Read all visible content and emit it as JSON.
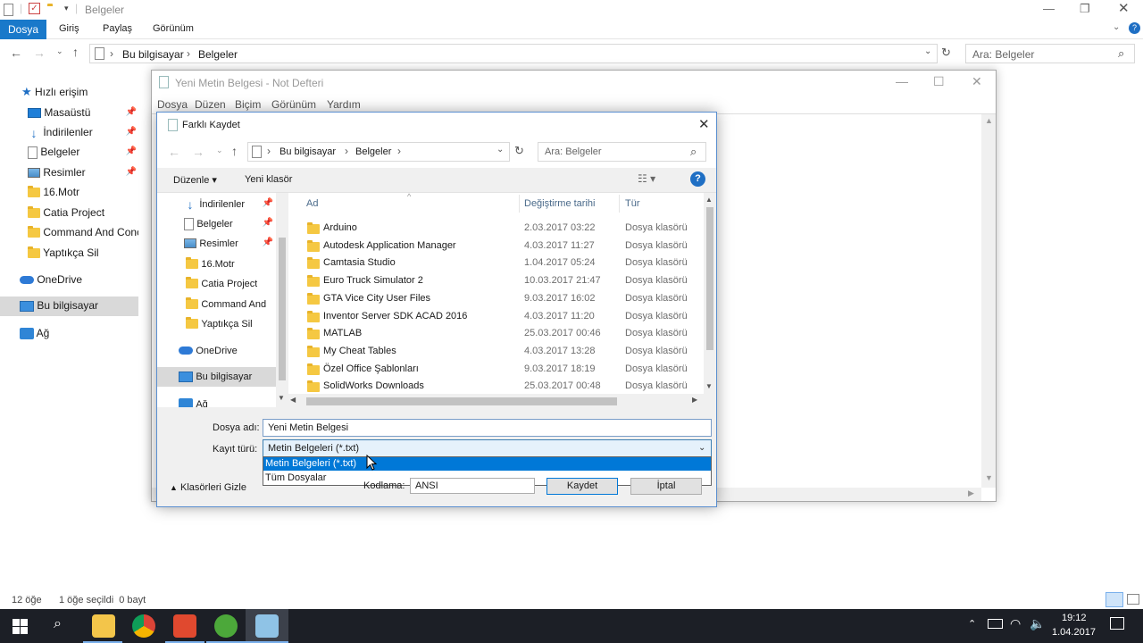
{
  "explorer": {
    "title": "Belgeler",
    "ribbon_tabs": [
      "Dosya",
      "Giriş",
      "Paylaş",
      "Görünüm"
    ],
    "address": [
      "Bu bilgisayar",
      "Belgeler"
    ],
    "search_placeholder": "Ara: Belgeler",
    "sidebar": {
      "quick_access": "Hızlı erişim",
      "items": [
        "Masaüstü",
        "İndirilenler",
        "Belgeler",
        "Resimler",
        "16.Motr",
        "Catia Project",
        "Command And Conc",
        "Yaptıkça Sil"
      ],
      "onedrive": "OneDrive",
      "this_pc": "Bu bilgisayar",
      "network": "Ağ"
    },
    "status": {
      "count": "12 öğe",
      "selected": "1 öğe seçildi  0 bayt"
    }
  },
  "notepad": {
    "title": "Yeni Metin Belgesi - Not Defteri",
    "menu": [
      "Dosya",
      "Düzen",
      "Biçim",
      "Görünüm",
      "Yardım"
    ]
  },
  "dialog": {
    "title": "Farklı Kaydet",
    "address": [
      "Bu bilgisayar",
      "Belgeler"
    ],
    "search_placeholder": "Ara: Belgeler",
    "organize": "Düzenle",
    "new_folder": "Yeni klasör",
    "help": "?",
    "left_items": [
      "İndirilenler",
      "Belgeler",
      "Resimler",
      "16.Motr",
      "Catia Project",
      "Command And",
      "Yaptıkça Sil",
      "OneDrive",
      "Bu bilgisayar",
      "Ağ"
    ],
    "columns": {
      "name": "Ad",
      "date": "Değiştirme tarihi",
      "type": "Tür"
    },
    "files": [
      {
        "name": "Arduino",
        "date": "2.03.2017 03:22",
        "type": "Dosya klasörü"
      },
      {
        "name": "Autodesk Application Manager",
        "date": "4.03.2017 11:27",
        "type": "Dosya klasörü"
      },
      {
        "name": "Camtasia Studio",
        "date": "1.04.2017 05:24",
        "type": "Dosya klasörü"
      },
      {
        "name": "Euro Truck Simulator 2",
        "date": "10.03.2017 21:47",
        "type": "Dosya klasörü"
      },
      {
        "name": "GTA Vice City User Files",
        "date": "9.03.2017 16:02",
        "type": "Dosya klasörü"
      },
      {
        "name": "Inventor Server SDK ACAD 2016",
        "date": "4.03.2017 11:20",
        "type": "Dosya klasörü"
      },
      {
        "name": "MATLAB",
        "date": "25.03.2017 00:46",
        "type": "Dosya klasörü"
      },
      {
        "name": "My Cheat Tables",
        "date": "4.03.2017 13:28",
        "type": "Dosya klasörü"
      },
      {
        "name": "Özel Office Şablonları",
        "date": "9.03.2017 18:19",
        "type": "Dosya klasörü"
      },
      {
        "name": "SolidWorks Downloads",
        "date": "25.03.2017 00:48",
        "type": "Dosya klasörü"
      }
    ],
    "filename_label": "Dosya adı:",
    "filename_value": "Yeni Metin Belgesi",
    "filetype_label": "Kayıt türü:",
    "filetype_value": "Metin Belgeleri (*.txt)",
    "filetype_options": [
      "Metin Belgeleri (*.txt)",
      "Tüm Dosyalar"
    ],
    "hide_folders": "Klasörleri Gizle",
    "encoding_label": "Kodlama:",
    "encoding_value": "ANSI",
    "save": "Kaydet",
    "cancel": "İptal"
  },
  "taskbar": {
    "time": "19:12",
    "date": "1.04.2017"
  },
  "colors": {
    "accent": "#0078d7",
    "file_tab": "#1979ca",
    "taskbar": "#1c1f26"
  }
}
